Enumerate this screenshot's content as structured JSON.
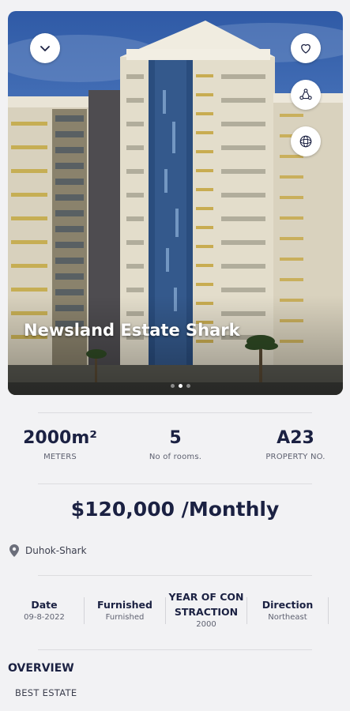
{
  "listing": {
    "title": "Newsland Estate Shark",
    "carousel": {
      "slide_count": 3,
      "active_index": 1
    }
  },
  "icons": {
    "collapse": "chevron-down-icon",
    "favorite": "heart-icon",
    "share": "share-icon",
    "view_360": "view-360-icon",
    "location": "map-pin-icon"
  },
  "stats": [
    {
      "value": "2000m²",
      "label": "METERS"
    },
    {
      "value": "5",
      "label": "No of rooms."
    },
    {
      "value": "A23",
      "label": "PROPERTY NO."
    }
  ],
  "price": "$120,000 /Monthly",
  "location": "Duhok-Shark",
  "details": [
    {
      "title": "Date",
      "value": "09-8-2022"
    },
    {
      "title": "Furnished",
      "value": "Furnished"
    },
    {
      "title": "YEAR OF CON STRACTION",
      "value": "2000"
    },
    {
      "title": "Direction",
      "value": "Northeast"
    }
  ],
  "overview": {
    "title": "OVERVIEW",
    "subtitle": "BEST ESTATE"
  },
  "colors": {
    "primary_text": "#1b2142",
    "background": "#f2f2f4",
    "card": "#ffffff"
  }
}
